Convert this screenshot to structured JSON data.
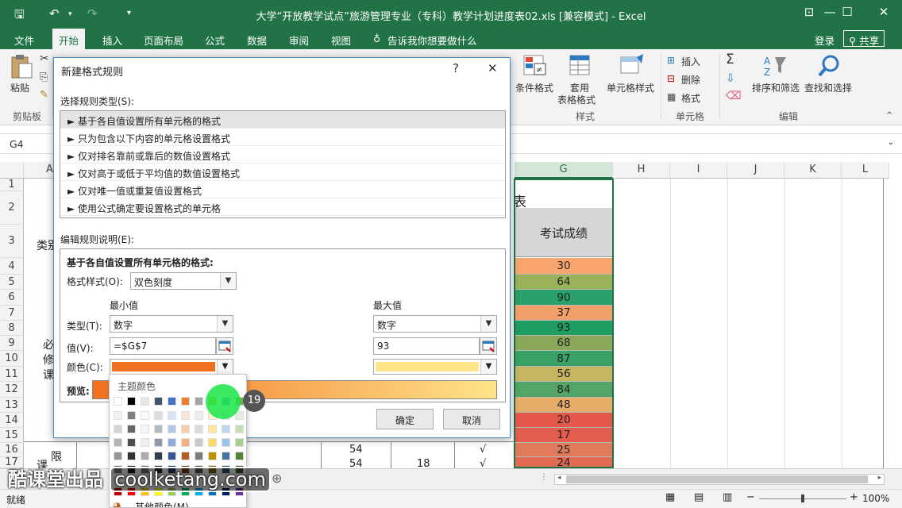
{
  "window": {
    "title": "大学“开放教学试点”旅游管理专业（专科）教学计划进度表02.xls  [兼容模式]  - Excel",
    "minimize": "—",
    "restore": "☐",
    "close": "✕"
  },
  "tabs": [
    "文件",
    "开始",
    "插入",
    "页面布局",
    "公式",
    "数据",
    "审阅",
    "视图"
  ],
  "tell_me": "告诉我你想要做什么",
  "account": {
    "login": "登录",
    "share": "共享"
  },
  "ribbon": {
    "paste": "粘贴",
    "clipboard_group": "剪贴板",
    "conditional_format": "条件格式",
    "format_as_table_1": "套用",
    "format_as_table_2": "表格格式",
    "cell_styles": "单元格样式",
    "styles_group": "样式",
    "insert": "插入",
    "delete": "删除",
    "format": "格式",
    "cells_group": "单元格",
    "sort_filter": "排序和筛选",
    "find_select": "查找和选择",
    "editing_group": "编辑"
  },
  "namebox": "G4",
  "columns": [
    "A",
    "G",
    "H",
    "I",
    "J",
    "K",
    "L"
  ],
  "rows": [
    "1",
    "2",
    "3",
    "4",
    "5",
    "6",
    "7",
    "8",
    "9",
    "10",
    "11",
    "12",
    "13",
    "14",
    "15",
    "16",
    "17"
  ],
  "sheet": {
    "title_fragment": "表",
    "score_header": "考试成绩",
    "category_fragment": "类别",
    "required_chars": [
      "必",
      "修",
      "课"
    ],
    "limited_chars": [
      "限",
      "课"
    ],
    "col_d_values": [
      "54",
      "54"
    ],
    "col_e_values": [
      "18"
    ],
    "col_f_values": [
      "√",
      "√"
    ],
    "scores": [
      30,
      64,
      90,
      37,
      93,
      68,
      87,
      56,
      84,
      48,
      20,
      17,
      25,
      24
    ],
    "score_colors": [
      "#f8a66e",
      "#9bb25a",
      "#2aa06a",
      "#f2a06a",
      "#1e9e62",
      "#8aa85a",
      "#3aa266",
      "#c5b662",
      "#52a564",
      "#e6ac68",
      "#e4574a",
      "#e35d4e",
      "#e07a5a",
      "#e36a52"
    ]
  },
  "status": {
    "ready": "就绪",
    "zoom": "100%"
  },
  "dialog": {
    "title": "新建格式规则",
    "help": "?",
    "close": "✕",
    "rule_type_label": "选择规则类型(S):",
    "rules": [
      "► 基于各自值设置所有单元格的格式",
      "► 只为包含以下内容的单元格设置格式",
      "► 仅对排名靠前或靠后的数值设置格式",
      "► 仅对高于或低于平均值的数值设置格式",
      "► 仅对唯一值或重复值设置格式",
      "► 使用公式确定要设置格式的单元格"
    ],
    "edit_label": "编辑规则说明(E):",
    "edit_heading": "基于各自值设置所有单元格的格式:",
    "format_style_label": "格式样式(O):",
    "format_style_value": "双色刻度",
    "min_label": "最小值",
    "max_label": "最大值",
    "type_label": "类型(T):",
    "min_type": "数字",
    "max_type": "数字",
    "value_label": "值(V):",
    "min_value": "=$G$7",
    "max_value": "93",
    "color_label": "颜色(C):",
    "min_color": "#f07020",
    "max_color": "#ffe48a",
    "preview_label": "预览:",
    "ok": "确定",
    "cancel": "取消"
  },
  "picker": {
    "theme_colors_label": "主题颜色",
    "more_colors": "其他颜色(M)...",
    "theme_row": [
      "#ffffff",
      "#000000",
      "#e7e6e6",
      "#44546a",
      "#4472c4",
      "#ed7d31",
      "#a5a5a5",
      "#ffc000",
      "#5b9bd5",
      "#70ad47"
    ],
    "standard_row": [
      "#c00000",
      "#ff0000",
      "#ffc000",
      "#ffff00",
      "#92d050",
      "#00b050",
      "#00b0f0",
      "#0070c0",
      "#002060",
      "#7030a0"
    ]
  },
  "step_number": "19",
  "watermark": {
    "brand": "酷课堂出品",
    "url": "coolketang.com"
  }
}
